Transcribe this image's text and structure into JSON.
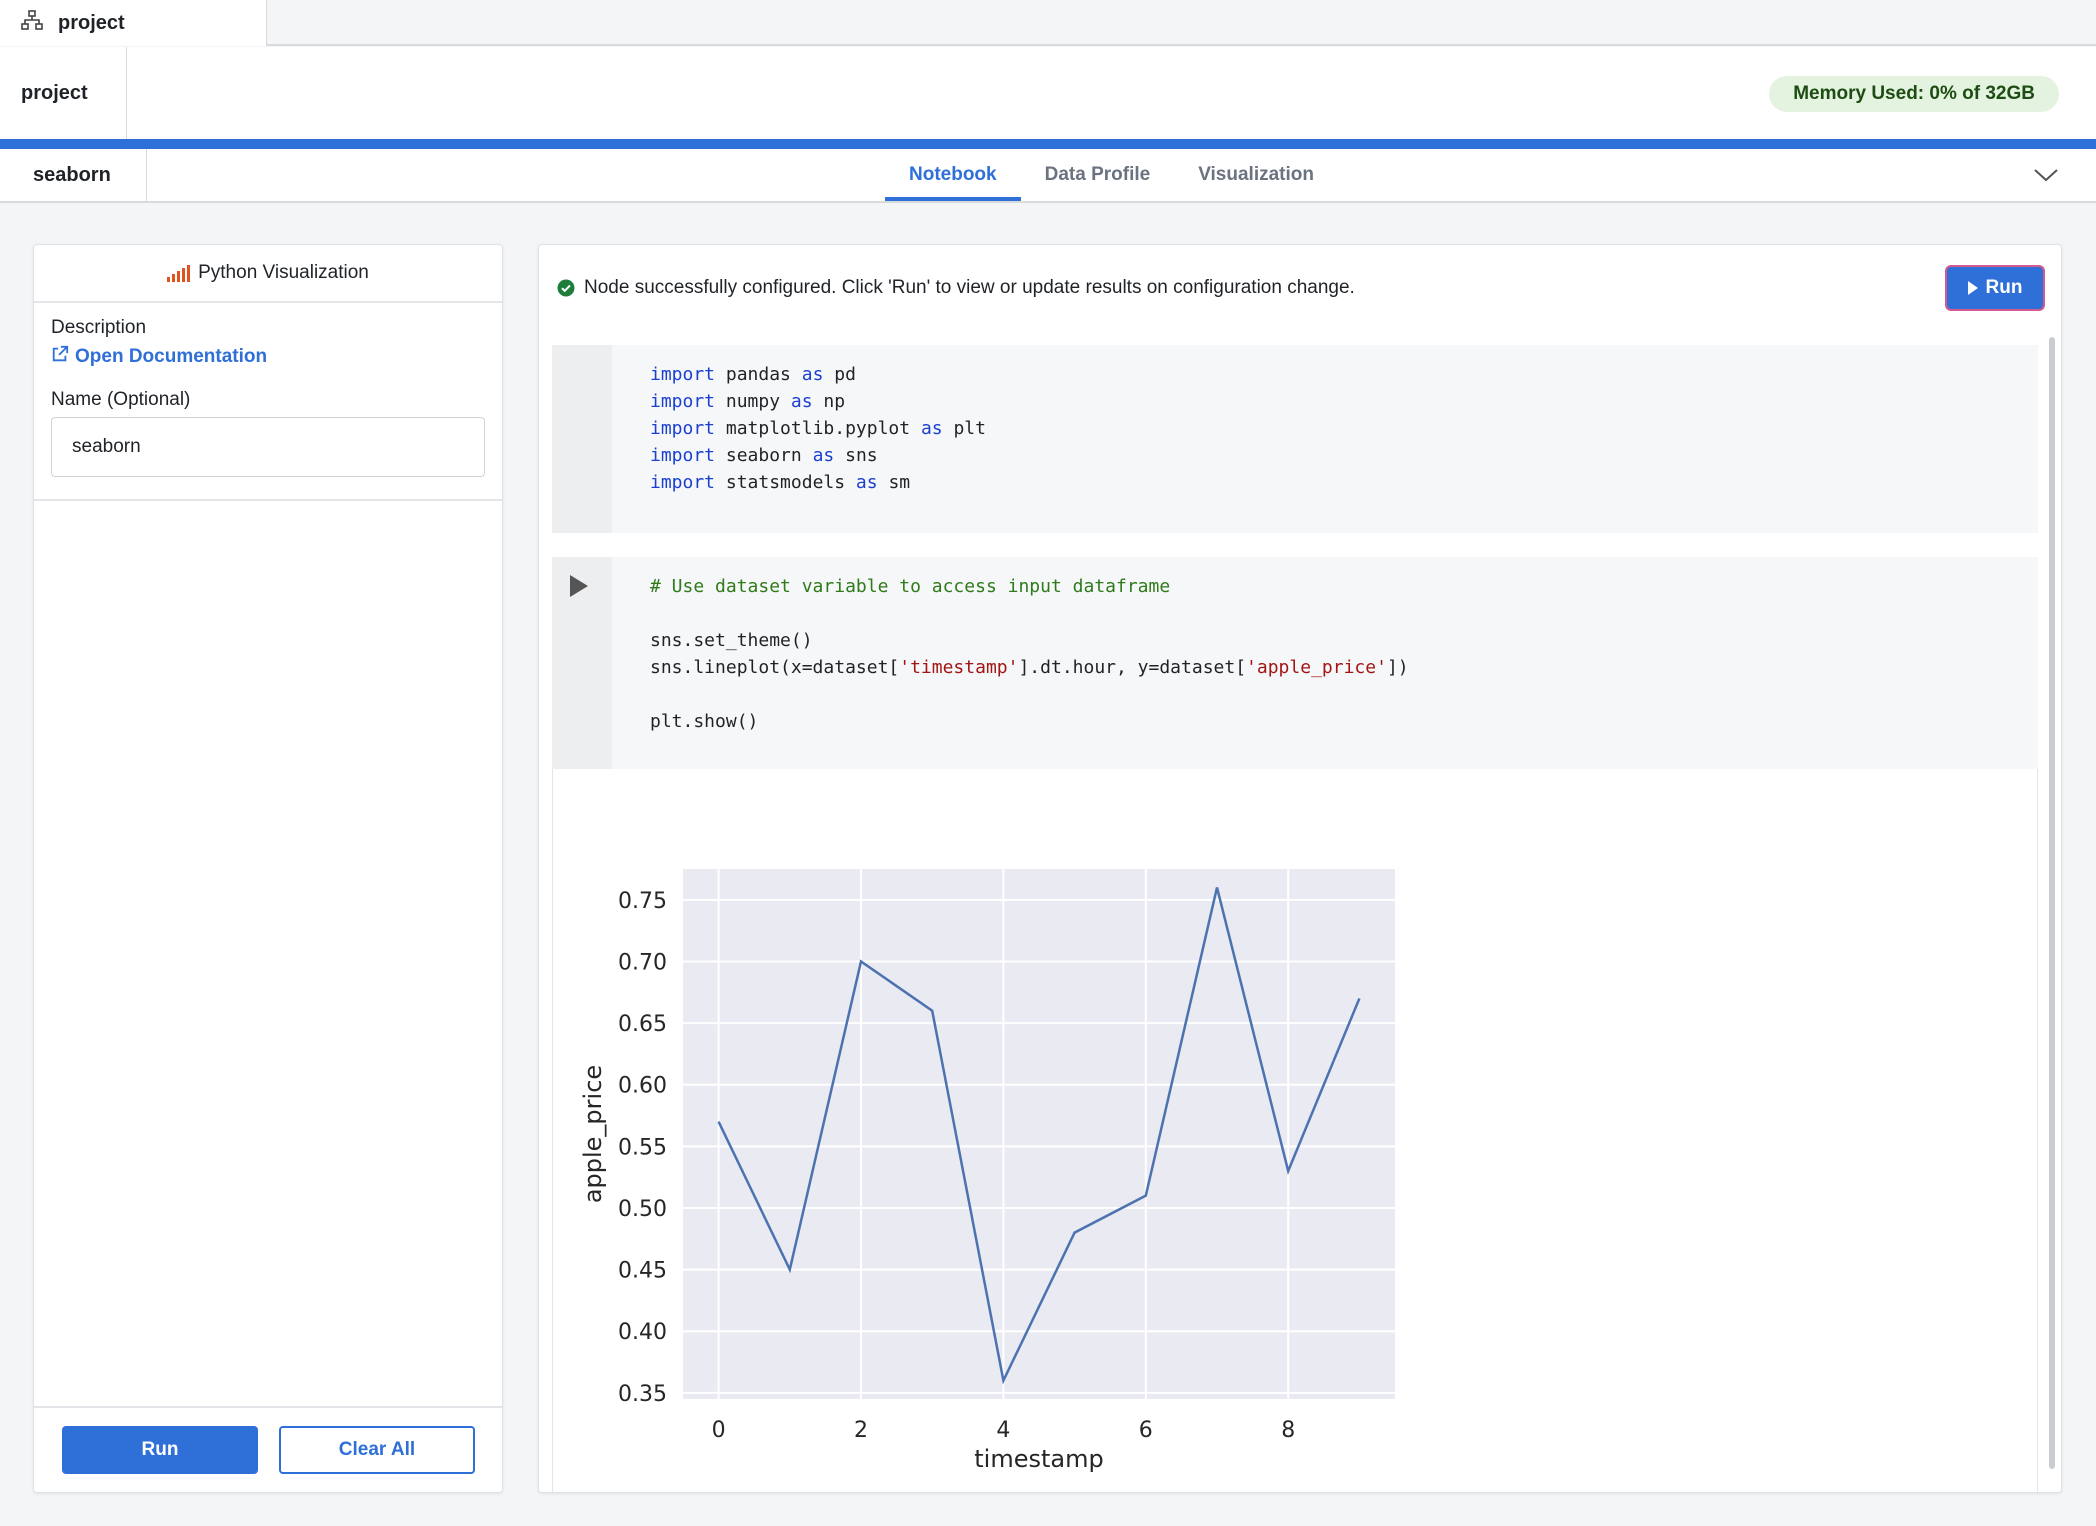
{
  "window_tab": {
    "title": "project",
    "icon": "sitemap-icon"
  },
  "project": {
    "name": "project",
    "memory_label": "Memory Used: 0% of 32GB"
  },
  "node": {
    "name": "seaborn",
    "tabs": [
      {
        "label": "Notebook",
        "active": true
      },
      {
        "label": "Data Profile",
        "active": false
      },
      {
        "label": "Visualization",
        "active": false
      }
    ],
    "collapse_icon": "chevron-down-icon"
  },
  "left_panel": {
    "title": "Python Visualization",
    "title_icon": "bar-signal-icon",
    "description_label": "Description",
    "doc_link": "Open Documentation",
    "name_label": "Name (Optional)",
    "name_value": "seaborn",
    "run_label": "Run",
    "clear_label": "Clear All"
  },
  "right_panel": {
    "status_text": "Node successfully configured. Click 'Run' to view or update results on configuration change.",
    "run_label": "Run"
  },
  "colors": {
    "accent": "#2f6fd8",
    "success": "#1e7d3a",
    "memory_bg": "#e4f3df",
    "line": "#4c72b0",
    "plot_bg": "#eaeaf2"
  },
  "chart_data": {
    "type": "line",
    "xlabel": "timestamp",
    "ylabel": "apple_price",
    "x": [
      0,
      1,
      2,
      3,
      4,
      5,
      6,
      7,
      8,
      9
    ],
    "series": [
      {
        "values": [
          0.57,
          0.45,
          0.7,
          0.66,
          0.36,
          0.48,
          0.51,
          0.76,
          0.53,
          0.67
        ]
      }
    ],
    "xlim": [
      -0.5,
      9.5
    ],
    "ylim": [
      0.345,
      0.775
    ],
    "xticks": [
      0,
      2,
      4,
      6,
      8
    ],
    "yticks": [
      0.35,
      0.4,
      0.45,
      0.5,
      0.55,
      0.6,
      0.65,
      0.7,
      0.75
    ],
    "grid": true
  }
}
